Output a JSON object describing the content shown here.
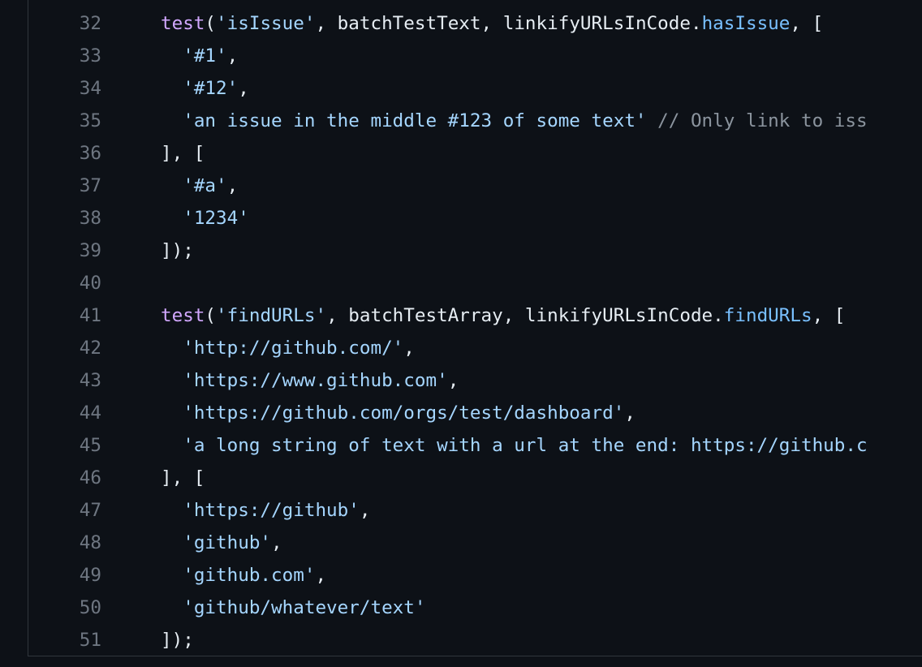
{
  "colors": {
    "background": "#0d1117",
    "line_number": "#6e7681",
    "plain": "#e6edf3",
    "function": "#d2a8ff",
    "string": "#a5d6ff",
    "property": "#79c0ff",
    "comment": "#8b949e"
  },
  "code": {
    "lines": [
      {
        "n": "32",
        "tokens": [
          {
            "t": "test",
            "k": "fn"
          },
          {
            "t": "(",
            "k": "pl"
          },
          {
            "t": "'isIssue'",
            "k": "str"
          },
          {
            "t": ", batchTestText, linkifyURLsInCode.",
            "k": "pl"
          },
          {
            "t": "hasIssue",
            "k": "prop"
          },
          {
            "t": ", [",
            "k": "pl"
          }
        ]
      },
      {
        "n": "33",
        "tokens": [
          {
            "t": "  ",
            "k": "pl"
          },
          {
            "t": "'#1'",
            "k": "str"
          },
          {
            "t": ",",
            "k": "pl"
          }
        ]
      },
      {
        "n": "34",
        "tokens": [
          {
            "t": "  ",
            "k": "pl"
          },
          {
            "t": "'#12'",
            "k": "str"
          },
          {
            "t": ",",
            "k": "pl"
          }
        ]
      },
      {
        "n": "35",
        "tokens": [
          {
            "t": "  ",
            "k": "pl"
          },
          {
            "t": "'an issue in the middle #123 of some text'",
            "k": "str"
          },
          {
            "t": " ",
            "k": "pl"
          },
          {
            "t": "// Only link to iss",
            "k": "cm"
          }
        ]
      },
      {
        "n": "36",
        "tokens": [
          {
            "t": "], [",
            "k": "pl"
          }
        ]
      },
      {
        "n": "37",
        "tokens": [
          {
            "t": "  ",
            "k": "pl"
          },
          {
            "t": "'#a'",
            "k": "str"
          },
          {
            "t": ",",
            "k": "pl"
          }
        ]
      },
      {
        "n": "38",
        "tokens": [
          {
            "t": "  ",
            "k": "pl"
          },
          {
            "t": "'1234'",
            "k": "str"
          }
        ]
      },
      {
        "n": "39",
        "tokens": [
          {
            "t": "]);",
            "k": "pl"
          }
        ]
      },
      {
        "n": "40",
        "tokens": []
      },
      {
        "n": "41",
        "tokens": [
          {
            "t": "test",
            "k": "fn"
          },
          {
            "t": "(",
            "k": "pl"
          },
          {
            "t": "'findURLs'",
            "k": "str"
          },
          {
            "t": ", batchTestArray, linkifyURLsInCode.",
            "k": "pl"
          },
          {
            "t": "findURLs",
            "k": "prop"
          },
          {
            "t": ", [",
            "k": "pl"
          }
        ]
      },
      {
        "n": "42",
        "tokens": [
          {
            "t": "  ",
            "k": "pl"
          },
          {
            "t": "'http://github.com/'",
            "k": "str"
          },
          {
            "t": ",",
            "k": "pl"
          }
        ]
      },
      {
        "n": "43",
        "tokens": [
          {
            "t": "  ",
            "k": "pl"
          },
          {
            "t": "'https://www.github.com'",
            "k": "str"
          },
          {
            "t": ",",
            "k": "pl"
          }
        ]
      },
      {
        "n": "44",
        "tokens": [
          {
            "t": "  ",
            "k": "pl"
          },
          {
            "t": "'https://github.com/orgs/test/dashboard'",
            "k": "str"
          },
          {
            "t": ",",
            "k": "pl"
          }
        ]
      },
      {
        "n": "45",
        "tokens": [
          {
            "t": "  ",
            "k": "pl"
          },
          {
            "t": "'a long string of text with a url at the end: https://github.c",
            "k": "str"
          }
        ]
      },
      {
        "n": "46",
        "tokens": [
          {
            "t": "], [",
            "k": "pl"
          }
        ]
      },
      {
        "n": "47",
        "tokens": [
          {
            "t": "  ",
            "k": "pl"
          },
          {
            "t": "'https://github'",
            "k": "str"
          },
          {
            "t": ",",
            "k": "pl"
          }
        ]
      },
      {
        "n": "48",
        "tokens": [
          {
            "t": "  ",
            "k": "pl"
          },
          {
            "t": "'github'",
            "k": "str"
          },
          {
            "t": ",",
            "k": "pl"
          }
        ]
      },
      {
        "n": "49",
        "tokens": [
          {
            "t": "  ",
            "k": "pl"
          },
          {
            "t": "'github.com'",
            "k": "str"
          },
          {
            "t": ",",
            "k": "pl"
          }
        ]
      },
      {
        "n": "50",
        "tokens": [
          {
            "t": "  ",
            "k": "pl"
          },
          {
            "t": "'github/whatever/text'",
            "k": "str"
          }
        ]
      },
      {
        "n": "51",
        "tokens": [
          {
            "t": "]);",
            "k": "pl"
          }
        ]
      }
    ]
  }
}
